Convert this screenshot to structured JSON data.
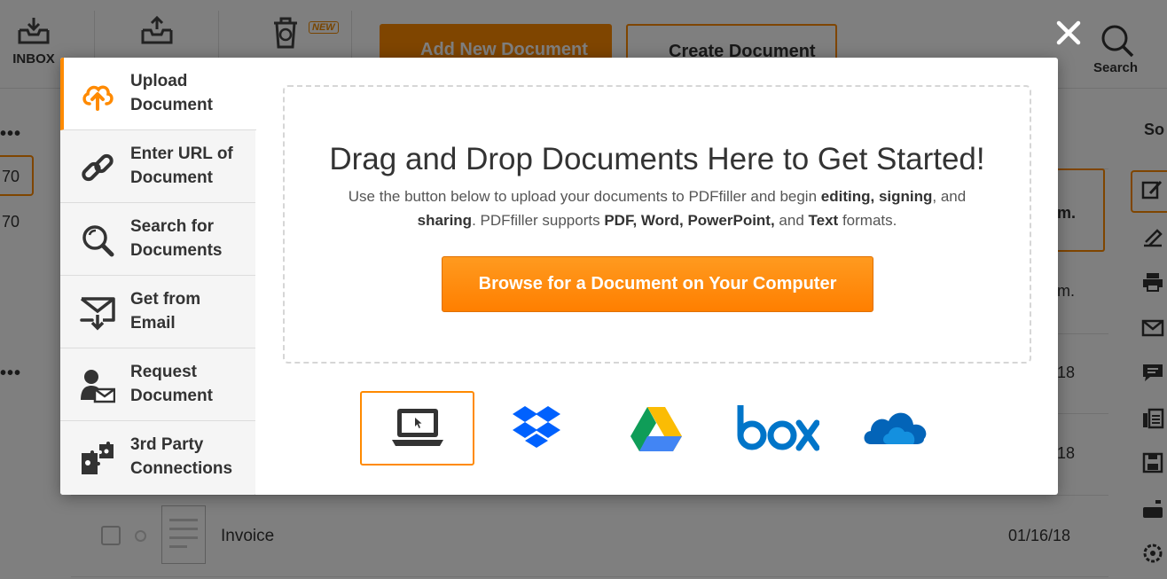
{
  "toolbar": {
    "inbox_label": "INBOX",
    "new_badge": "NEW",
    "add_button": "Add New Document",
    "create_button": "Create Document",
    "search_label": "Search"
  },
  "background": {
    "dots": "•••",
    "count_highlighted": "70",
    "count_plain": "70",
    "sort_label": "So",
    "card_text": "m.",
    "row_text_2": "m.",
    "date_1": "18",
    "date_2": "18",
    "invoice_name": "Invoice",
    "invoice_date": "01/16/18"
  },
  "modal": {
    "sidebar": [
      {
        "label": "Upload Document",
        "icon": "upload-cloud-icon",
        "active": true
      },
      {
        "label": "Enter URL of Document",
        "icon": "link-icon",
        "active": false
      },
      {
        "label": "Search for Documents",
        "icon": "search-icon",
        "active": false
      },
      {
        "label": "Get from Email",
        "icon": "email-download-icon",
        "active": false
      },
      {
        "label": "Request Document",
        "icon": "request-user-icon",
        "active": false
      },
      {
        "label": "3rd Party Connections",
        "icon": "puzzle-icon",
        "active": false
      }
    ],
    "drop_title": "Drag and Drop Documents Here to Get Started!",
    "desc_1": "Use the button below to upload your documents to PDFfiller and begin ",
    "desc_bold_1": "editing, signing",
    "desc_2": ", and ",
    "desc_bold_2": "sharing",
    "desc_3": ". PDFfiller supports ",
    "desc_bold_3": "PDF, Word, PowerPoint,",
    "desc_4": " and ",
    "desc_bold_4": "Text",
    "desc_5": " formats.",
    "browse_button": "Browse for a Document on Your Computer",
    "sources": [
      "my-computer",
      "dropbox",
      "google-drive",
      "box",
      "onedrive"
    ]
  },
  "colors": {
    "accent": "#ff8a00",
    "dropbox": "#0061fe",
    "box": "#0075c9",
    "onedrive": "#0364b8"
  }
}
